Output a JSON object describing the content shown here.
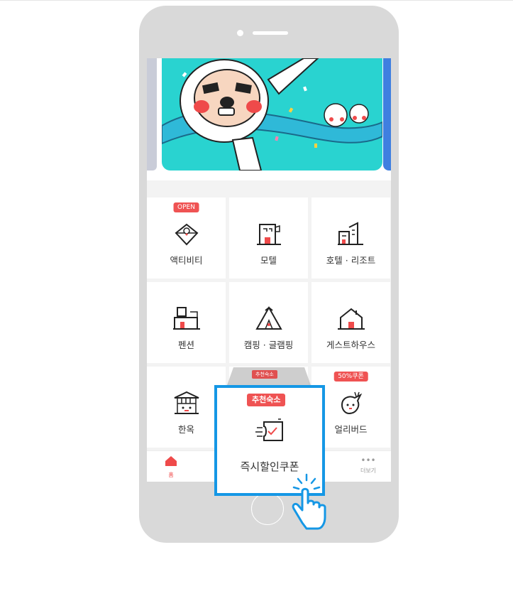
{
  "categories": [
    {
      "label": "액티비티",
      "badge": "OPEN",
      "icon": "activity-icon"
    },
    {
      "label": "모텔",
      "badge": "",
      "icon": "motel-icon"
    },
    {
      "label": "호텔 · 리조트",
      "badge": "",
      "icon": "hotel-icon"
    },
    {
      "label": "펜션",
      "badge": "",
      "icon": "pension-icon"
    },
    {
      "label": "캠핑 · 글램핑",
      "badge": "",
      "icon": "camping-icon"
    },
    {
      "label": "게스트하우스",
      "badge": "",
      "icon": "guesthouse-icon"
    },
    {
      "label": "한옥",
      "badge": "",
      "icon": "hanok-icon"
    },
    {
      "label": "",
      "badge": "추천숙소",
      "icon": ""
    },
    {
      "label": "얼리버드",
      "badge": "50%쿠폰",
      "icon": "earlybird-icon"
    }
  ],
  "highlight": {
    "badge": "추천숙소",
    "label": "즉시할인쿠폰",
    "icon": "coupon-icon"
  },
  "nav": [
    {
      "label": "홈",
      "icon": "home-icon",
      "active": true
    },
    {
      "label": "",
      "icon": "",
      "active": false
    },
    {
      "label": "",
      "icon": "",
      "active": false
    },
    {
      "label": "",
      "icon": "",
      "active": false
    },
    {
      "label": "더보기",
      "icon": "more-icon",
      "active": false
    }
  ],
  "colors": {
    "accent": "#ef5353",
    "highlight_border": "#1597e5",
    "banner_bg": "#29d3d0",
    "nav_active": "#ef4a4a"
  }
}
